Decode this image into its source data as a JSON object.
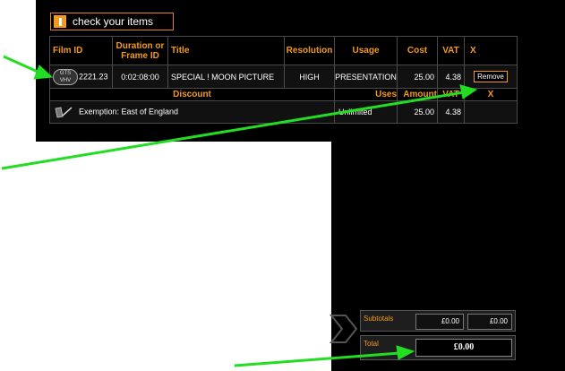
{
  "header": {
    "title": "check your items",
    "icon": "exclamation-icon"
  },
  "columns": [
    "Film ID",
    "Duration or Frame ID",
    "Title",
    "Resolution",
    "Usage",
    "Cost",
    "VAT",
    "X"
  ],
  "item": {
    "film_id": "2221.23",
    "badge_top": "GTS",
    "badge_bottom": "VHV",
    "duration": "0:02:08:00",
    "title": "SPECIAL ! MOON PICTURE",
    "resolution": "HIGH",
    "usage": "PRESENTATION",
    "cost": "25.00",
    "vat": "4.38",
    "remove_label": "Remove"
  },
  "discount_columns": [
    "Discount",
    "Uses",
    "Amount",
    "VAT",
    "X"
  ],
  "discount": {
    "name": "Exemption: East of England",
    "uses": "Unlimited",
    "amount": "25.00",
    "vat": "4.38",
    "icon": "pen-icon"
  },
  "summary": {
    "subtotals_label": "Subtotals",
    "subtotal_cost": "£0.00",
    "subtotal_vat": "£0.00",
    "total_label": "Total",
    "total": "£0.00"
  },
  "colors": {
    "accent": "#f29a1f",
    "arrow": "#22dd22",
    "panel": "#000000"
  }
}
